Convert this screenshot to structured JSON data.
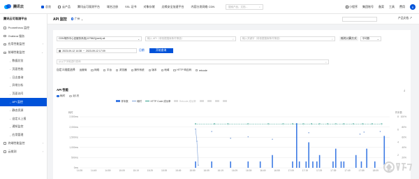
{
  "top": {
    "logo": "腾讯云",
    "nav": [
      "总览",
      "云产品",
      "腾讯云可观测平台",
      "域名注册",
      "SSL 证书",
      "对象存储",
      "边缘安全加速平台",
      "内容分发网络 CDN"
    ],
    "search_placeholder": "搜索产品、文档...",
    "right": [
      "小程序",
      "集团账号",
      "备案",
      "工具",
      "费用"
    ],
    "avatar": "S"
  },
  "sidebar": {
    "title": "腾讯云可观测平台",
    "items": [
      {
        "label": "Prometheus 监控",
        "type": "top"
      },
      {
        "label": "Grafana 服务",
        "type": "top"
      },
      {
        "label": "应用性能监控",
        "type": "top",
        "chev": "›"
      },
      {
        "label": "前端性能监控",
        "type": "top",
        "chev": "⌄"
      },
      {
        "label": "数据总览",
        "type": "sub"
      },
      {
        "label": "页面性能",
        "type": "sub"
      },
      {
        "label": "日志查询",
        "type": "sub"
      },
      {
        "label": "异常分析",
        "type": "sub"
      },
      {
        "label": "页面访问",
        "type": "sub"
      },
      {
        "label": "API 监控",
        "type": "sub",
        "active": true
      },
      {
        "label": "静态资源",
        "type": "sub"
      },
      {
        "label": "自定义上报",
        "type": "sub"
      },
      {
        "label": "通知监控",
        "type": "sub"
      },
      {
        "label": "应用管理",
        "type": "sub"
      },
      {
        "label": "终端性能监控",
        "type": "top",
        "chev": "›"
      },
      {
        "label": "云拨测",
        "type": "top",
        "chev": "›"
      }
    ]
  },
  "page": {
    "title": "API 监控",
    "region": "广州",
    "doc": "产品文档"
  },
  "filters": {
    "app": "CDN场所中心旧服务系统(127862)(web).sit",
    "api_placeholder": "输入 API（将依据搜索条件筛选）",
    "contain_placeholder": "输入关键字（将依据搜索条件筛选）",
    "time_label": "耗时计算方式",
    "time_method": "平均数",
    "date_start": "2023-09-12 14:38",
    "date_end": "2023-09-12 17:09",
    "date_sep": "~",
    "date_link": "日期",
    "query": "开始查询",
    "fields_placeholder": "从以下字段进行查询",
    "checks_label": "自定义维度选择",
    "checks": [
      "运营商",
      "网络",
      "平台",
      "浏览器",
      "操作系统",
      "版本",
      "地域",
      "HTTP 响应码",
      "retcode"
    ]
  },
  "chart": {
    "title": "API 性能",
    "download": "⤓",
    "radios": [
      "耗时",
      "近1天"
    ],
    "legend": [
      {
        "label": "样本数",
        "on": true
      },
      {
        "label": "耗时",
        "on": true
      },
      {
        "label": "HTTP Code 成功率",
        "on": true
      },
      {
        "label": "Retcode 成功率",
        "on": false
      },
      {
        "label": "",
        "on": false
      },
      {
        "label": "",
        "on": false
      },
      {
        "label": "",
        "on": false
      },
      {
        "label": "",
        "on": false
      }
    ],
    "colors": {
      "bar": "#3c7ae4",
      "line": "#7b9fd8",
      "dash": "#2e9c8a",
      "grid": "#e8e8e8"
    }
  },
  "chart_data": {
    "type": "bar",
    "left_axis_title": "耗时",
    "right_axis_title": "样本数",
    "left_ticks": [
      "2,500ms",
      "2,000ms",
      "1,500ms",
      "1,000ms",
      "500ms",
      "0ms"
    ],
    "right_ticks": [
      "8",
      "6",
      "4",
      "2",
      "0"
    ],
    "right_ticks_2": [
      "100%",
      "80%",
      "60%",
      "40%",
      "20%",
      "0%"
    ],
    "x_ticks": [
      "14:39",
      "14:49",
      "14:59",
      "15:09",
      "15:19",
      "15:29",
      "15:39",
      "15:49",
      "15:59",
      "16:09",
      "16:19",
      "16:29",
      "16:39",
      "16:49",
      "16:59",
      "17:09",
      "17:19",
      "17:29",
      "17:39",
      "17:49",
      "17:59",
      "18:09",
      "18:19"
    ],
    "x_range": [
      0,
      230
    ],
    "left_range": [
      0,
      2500
    ],
    "right_range": [
      0,
      8
    ],
    "bars": [
      {
        "x": 86,
        "v": 1
      },
      {
        "x": 98,
        "v": 1
      },
      {
        "x": 112,
        "v": 1
      },
      {
        "x": 125,
        "v": 1
      },
      {
        "x": 134,
        "v": 1
      },
      {
        "x": 143,
        "v": 2
      },
      {
        "x": 158,
        "v": 1
      },
      {
        "x": 161,
        "v": 7
      },
      {
        "x": 163,
        "v": 1
      },
      {
        "x": 168,
        "v": 1
      },
      {
        "x": 170,
        "v": 4
      },
      {
        "x": 173,
        "v": 1
      },
      {
        "x": 176,
        "v": 1
      },
      {
        "x": 178,
        "v": 2
      },
      {
        "x": 188,
        "v": 1
      },
      {
        "x": 190,
        "v": 3
      },
      {
        "x": 194,
        "v": 1
      },
      {
        "x": 196,
        "v": 1
      },
      {
        "x": 205,
        "v": 2
      },
      {
        "x": 209,
        "v": 1
      },
      {
        "x": 213,
        "v": 3
      },
      {
        "x": 219,
        "v": 1
      },
      {
        "x": 226,
        "v": 5
      }
    ],
    "latency_points": [
      {
        "x": 86,
        "v": 1900
      },
      {
        "x": 87,
        "v": 1300
      },
      {
        "x": 88,
        "v": 130
      },
      {
        "x": 98,
        "v": 1780
      },
      {
        "x": 112,
        "v": 1450
      },
      {
        "x": 143,
        "v": 1400
      },
      {
        "x": 125,
        "v": 1520
      },
      {
        "x": 170,
        "v": 1720
      },
      {
        "x": 208,
        "v": 1650
      },
      {
        "x": 211,
        "v": 1750
      },
      {
        "x": 223,
        "v": 1780
      }
    ],
    "success_points": [
      86,
      100,
      110,
      125,
      140,
      151,
      158,
      166,
      172,
      178,
      184,
      190,
      196,
      203,
      210,
      217,
      224
    ]
  }
}
